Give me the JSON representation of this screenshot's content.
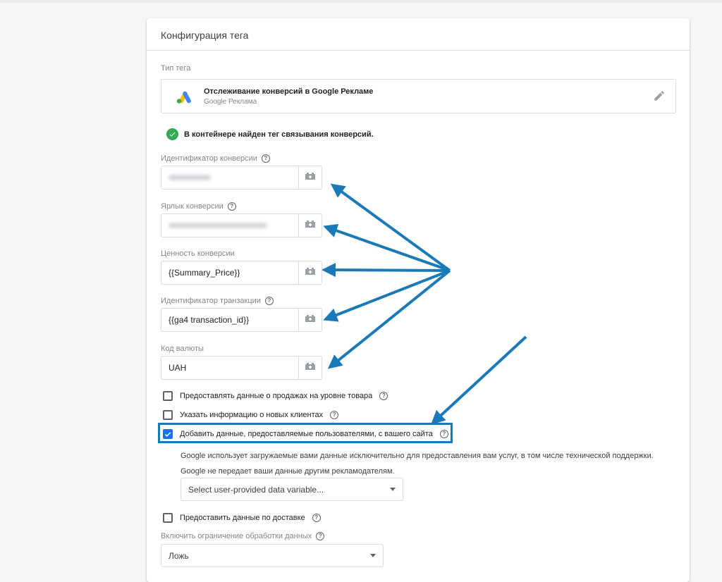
{
  "card": {
    "title": "Конфигурация тега"
  },
  "tag_type": {
    "label": "Тип тега",
    "name": "Отслеживание конверсий в Google Рекламе",
    "vendor": "Google Реклама",
    "logo_icon": "google-ads-logo",
    "edit_icon": "pencil-icon"
  },
  "notice": {
    "text": "В контейнере найден тег связывания конверсий.",
    "icon": "check-circle-icon",
    "color": "#34a853"
  },
  "fields": [
    {
      "label": "Идентификатор конверсии",
      "value": "",
      "has_help": true
    },
    {
      "label": "Ярлык конверсии",
      "value": "",
      "has_help": true
    },
    {
      "label": "Ценность конверсии",
      "value": "{{Summary_Price}}",
      "has_help": false
    },
    {
      "label": "Идентификатор транзакции",
      "value": "{{ga4 transaction_id}}",
      "has_help": true
    },
    {
      "label": "Код валюты",
      "value": "UAH",
      "has_help": false
    }
  ],
  "checkboxes": [
    {
      "label": "Предоставлять данные о продажах на уровне товара",
      "checked": false
    },
    {
      "label": "Указать информацию о новых клиентах",
      "checked": false
    },
    {
      "label": "Добавить данные, предоставляемые пользователями, с вашего сайта",
      "checked": true
    }
  ],
  "user_data": {
    "description": "Google использует загружаемые вами данные исключительно для предоставления вам услуг, в том числе технической поддержки. Google не передает ваши данные другим рекламодателям.",
    "select_value": "Select user-provided data variable..."
  },
  "shipping": {
    "label": "Предоставить данные по доставке",
    "checked": false
  },
  "restricted": {
    "label": "Включить ограничение обработки данных",
    "value": "Ложь"
  },
  "colors": {
    "accent": "#1a73e8",
    "annotation": "#1a7ab8",
    "success": "#34a853"
  }
}
